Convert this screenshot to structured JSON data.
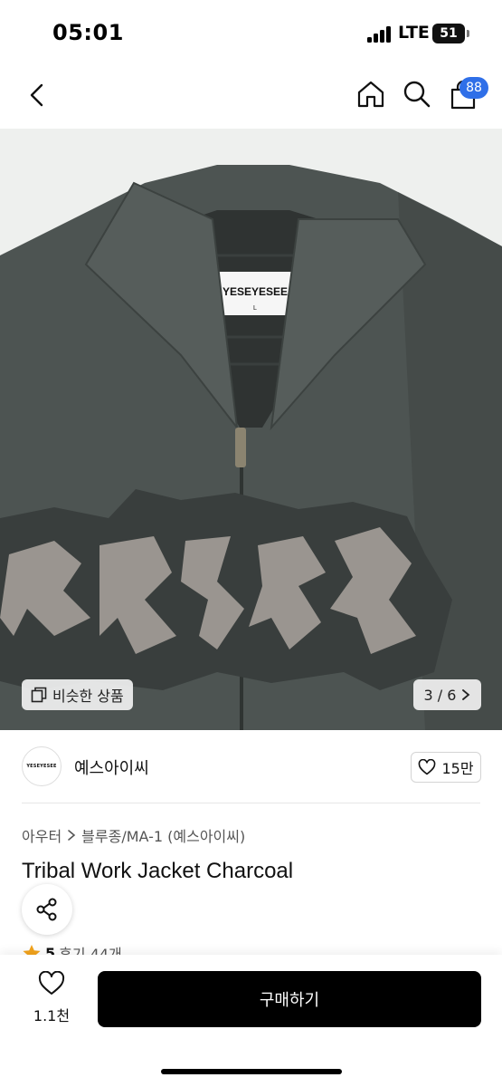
{
  "status_bar": {
    "time": "05:01",
    "network": "LTE",
    "battery": "51"
  },
  "nav": {
    "back_icon": "chevron-left-icon",
    "home_icon": "home-icon",
    "search_icon": "search-icon",
    "cart_icon": "shopping-bag-icon",
    "cart_badge": "88",
    "badge_color": "#2f6fe8"
  },
  "image": {
    "label_text": "YESEYESEE",
    "label_size": "L",
    "similar_label": "비슷한 상품",
    "counter": "3 / 6"
  },
  "brand": {
    "logo_text": "YESEYESEE",
    "name": "예스아이씨",
    "likes": "15만"
  },
  "product": {
    "breadcrumb_1": "아우터",
    "breadcrumb_2": "블루종/MA-1 (예스아이씨)",
    "title": "Tribal Work Jacket Charcoal",
    "rating": "5",
    "reviews": "후기 44개"
  },
  "footer": {
    "wish_count": "1.1천",
    "buy_label": "구매하기"
  }
}
